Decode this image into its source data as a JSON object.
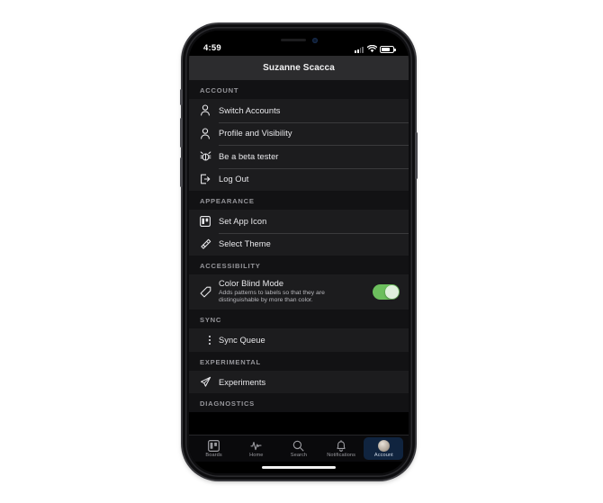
{
  "status_bar": {
    "time": "4:59",
    "signal_icon": "cellular-signal-icon",
    "wifi_icon": "wifi-icon",
    "battery_icon": "battery-icon"
  },
  "navbar": {
    "title": "Suzanne Scacca"
  },
  "sections": [
    {
      "header": "ACCOUNT",
      "rows": [
        {
          "label": "Switch Accounts",
          "icon": "person-icon"
        },
        {
          "label": "Profile and Visibility",
          "icon": "person-icon"
        },
        {
          "label": "Be a beta tester",
          "icon": "bug-icon"
        },
        {
          "label": "Log Out",
          "icon": "logout-icon"
        }
      ]
    },
    {
      "header": "APPEARANCE",
      "rows": [
        {
          "label": "Set App Icon",
          "icon": "board-icon"
        },
        {
          "label": "Select Theme",
          "icon": "paintbrush-icon"
        }
      ]
    },
    {
      "header": "ACCESSIBILITY",
      "rows": [
        {
          "label": "Color Blind Mode",
          "sublabel": "Adds patterns to labels so that they are distinguishable by more than color.",
          "icon": "label-tag-icon",
          "toggle": "on",
          "toggle_color": "#6cbf5d"
        }
      ]
    },
    {
      "header": "SYNC",
      "rows": [
        {
          "label": "Sync Queue",
          "icon": "vertical-dots-icon"
        }
      ]
    },
    {
      "header": "EXPERIMENTAL",
      "rows": [
        {
          "label": "Experiments",
          "icon": "rocket-icon"
        }
      ]
    },
    {
      "header": "DIAGNOSTICS",
      "rows": []
    }
  ],
  "tabbar": {
    "tabs": [
      {
        "label": "Boards",
        "icon": "board-icon",
        "active": false
      },
      {
        "label": "Home",
        "icon": "activity-pulse-icon",
        "active": false
      },
      {
        "label": "Search",
        "icon": "search-icon",
        "active": false
      },
      {
        "label": "Notifications",
        "icon": "bell-icon",
        "active": false
      },
      {
        "label": "Account",
        "icon": "avatar-icon",
        "active": true
      }
    ],
    "active_highlight_color": "#10243f"
  }
}
